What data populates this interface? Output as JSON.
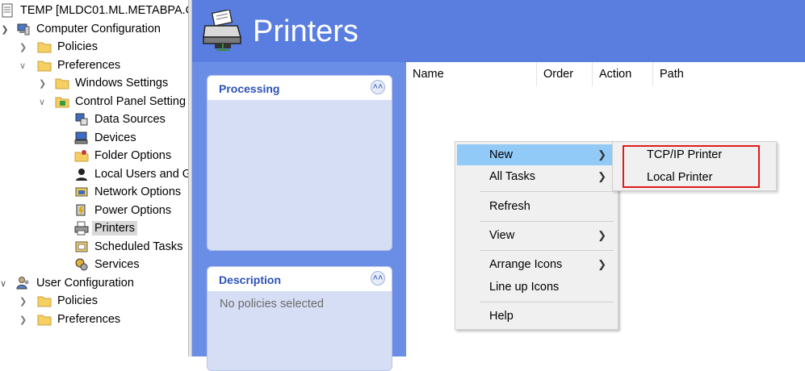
{
  "tree": {
    "root": "TEMP [MLDC01.ML.METABPA.C",
    "computer_config": "Computer Configuration",
    "policies": "Policies",
    "preferences": "Preferences",
    "windows_settings": "Windows Settings",
    "control_panel": "Control Panel Setting",
    "data_sources": "Data Sources",
    "devices": "Devices",
    "folder_options": "Folder Options",
    "local_users": "Local Users and G",
    "network_options": "Network Options",
    "power_options": "Power Options",
    "printers": "Printers",
    "scheduled_tasks": "Scheduled Tasks",
    "services": "Services",
    "user_config": "User Configuration",
    "user_policies": "Policies",
    "user_preferences": "Preferences"
  },
  "header": {
    "title": "Printers"
  },
  "processing": {
    "title": "Processing"
  },
  "description": {
    "title": "Description",
    "text": "No policies selected"
  },
  "list": {
    "columns": [
      "Name",
      "Order",
      "Action",
      "Path"
    ]
  },
  "context_menu": {
    "new": "New",
    "all_tasks": "All Tasks",
    "refresh": "Refresh",
    "view": "View",
    "arrange_icons": "Arrange Icons",
    "line_up_icons": "Line up Icons",
    "help": "Help"
  },
  "submenu": {
    "tcpip": "TCP/IP Printer",
    "local": "Local Printer"
  },
  "colors": {
    "header_blue": "#5a7ee0",
    "panel_blue": "#6a8ee6",
    "menu_highlight": "#91c9f7",
    "callout_red": "#e01b1b"
  }
}
